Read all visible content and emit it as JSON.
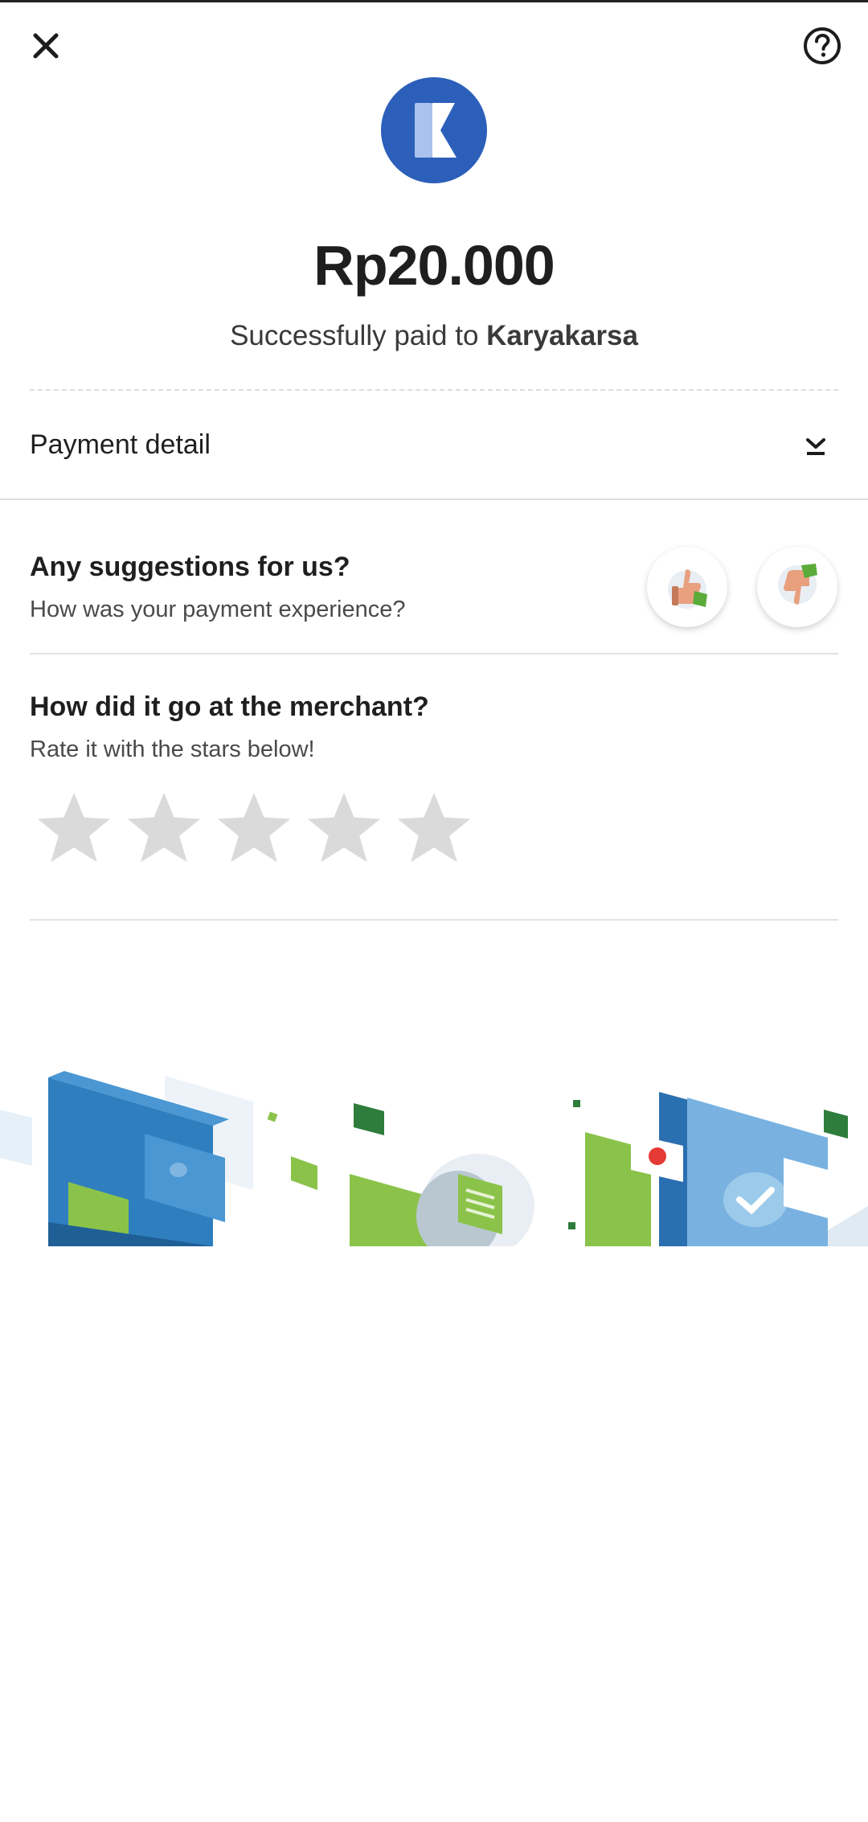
{
  "header": {
    "close_icon": "close-icon",
    "help_icon": "help-circle-icon"
  },
  "merchant": {
    "logo_letter": "K",
    "logo_color": "#2b5fb9"
  },
  "payment": {
    "amount": "Rp20.000",
    "status_prefix": "Successfully paid to ",
    "merchant_name": "Karyakarsa"
  },
  "payment_detail": {
    "label": "Payment detail",
    "toggle_icon": "chevron-down-icon"
  },
  "feedback": {
    "title": "Any suggestions for us?",
    "subtitle": "How was your payment experience?",
    "thumbs_up_icon": "thumbs-up-icon",
    "thumbs_down_icon": "thumbs-down-icon"
  },
  "merchant_rating": {
    "title": "How did it go at the merchant?",
    "subtitle": "Rate it with the stars below!",
    "max_stars": 5,
    "current_rating": 0
  },
  "colors": {
    "star_empty": "#dadada",
    "brand_green": "#8bc34a",
    "brand_blue": "#2f7fbf"
  }
}
